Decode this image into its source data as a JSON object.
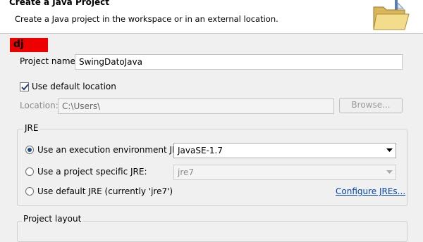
{
  "header": {
    "title": "Create a Java Project",
    "description": "Create a Java project in the workspace or in an external location."
  },
  "error_badge": "dj",
  "project_name": {
    "label": "Project name:",
    "value": "SwingDatoJava"
  },
  "default_location": {
    "label": "Use default location",
    "checked": true
  },
  "location": {
    "label": "Location:",
    "value": "C:\\Users\\",
    "browse_label": "Browse..."
  },
  "jre": {
    "group_label": "JRE",
    "options": [
      {
        "label": "Use an execution environment JRE:",
        "selected": true,
        "value": "JavaSE-1.7"
      },
      {
        "label": "Use a project specific JRE:",
        "selected": false,
        "value": "jre7"
      },
      {
        "label": "Use default JRE (currently 'jre7')",
        "selected": false
      }
    ],
    "configure_link": "Configure JREs..."
  },
  "project_layout": {
    "group_label": "Project layout"
  }
}
